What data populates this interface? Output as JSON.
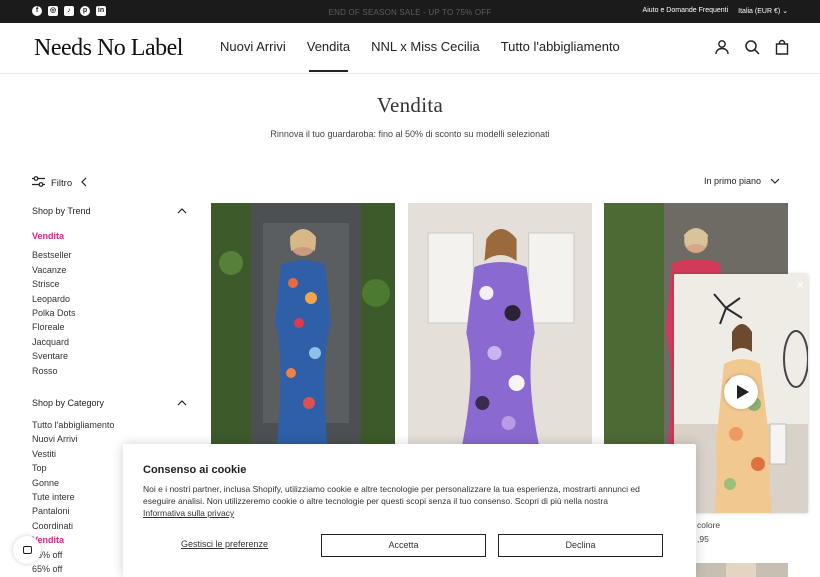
{
  "topbar": {
    "social": [
      {
        "icon": "facebook-icon",
        "glyph": "f"
      },
      {
        "icon": "instagram-icon",
        "glyph": "◎"
      },
      {
        "icon": "tiktok-icon",
        "glyph": "♪"
      },
      {
        "icon": "pinterest-icon",
        "glyph": "p"
      },
      {
        "icon": "linkedin-icon",
        "glyph": "in"
      }
    ],
    "promo": "END OF SEASON SALE - UP TO 75% OFF",
    "help_link": "Aiuto e Domande Frequenti",
    "region": "Italia (EUR €)"
  },
  "header": {
    "logo": "Needs No Label",
    "nav": [
      "Nuovi Arrivi",
      "Vendita",
      "NNL x Miss Cecilia",
      "Tutto l'abbigliamento"
    ],
    "active_nav": "Vendita"
  },
  "page": {
    "title": "Vendita",
    "subtitle": "Rinnova il tuo guardaroba: fino al 50% di sconto su modelli selezionati",
    "filter_label": "Filtro",
    "sort_label": "In primo piano"
  },
  "sidebar": {
    "trend_title": "Shop by Trend",
    "trend_items": [
      "Vendita",
      "Bestseller",
      "Vacanze",
      "Strisce",
      "Leopardo",
      "Polka Dots",
      "Floreale",
      "Jacquard",
      "Sventare",
      "Rosso"
    ],
    "category_title": "Shop by Category",
    "category_items": [
      "Tutto l'abbigliamento",
      "Nuovi Arrivi",
      "Vestiti",
      "Top",
      "Gonne",
      "Tute intere",
      "Pantaloni",
      "Coordinati",
      "Vendita",
      "75% off",
      "65% off"
    ]
  },
  "product_fragments": {
    "line1": "colore",
    "line2": ",95"
  },
  "video": {
    "close": "×"
  },
  "cookie": {
    "title": "Consenso ai cookie",
    "line1": "Noi e i nostri partner, inclusa Shopify, utilizziamo cookie e altre tecnologie per personalizzare la tua esperienza, mostrarti annunci ed",
    "line2": "eseguire analisi. Non utilizzeremo cookie o altre tecnologie per questi scopi senza il tuo consenso. Scopri di più nella nostra",
    "privacy_link": "Informativa sulla privacy",
    "preferences": "Gestisci le preferenze",
    "accept": "Accetta",
    "decline": "Declina"
  },
  "colors": {
    "accent_pink": "#e0228b",
    "topbar_bg": "#1b1b1b"
  }
}
